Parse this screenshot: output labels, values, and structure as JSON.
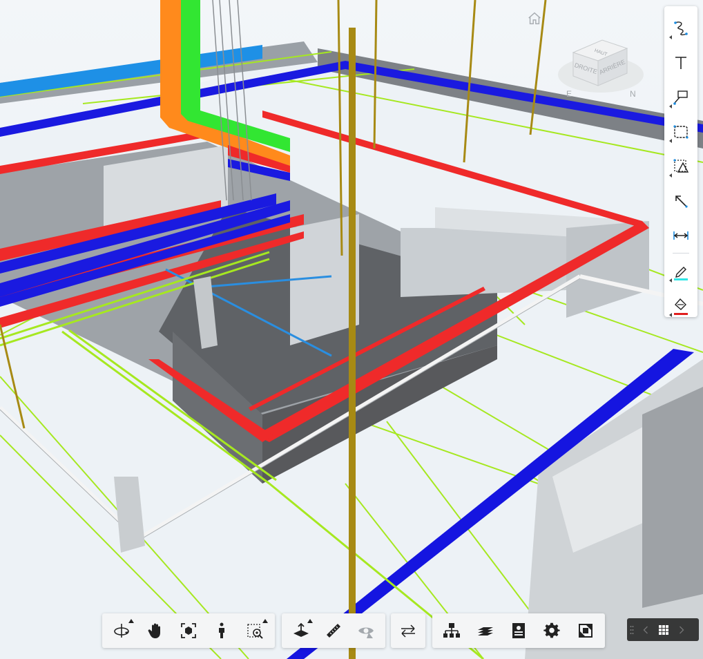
{
  "viewer": {
    "viewcube": {
      "face_top": "HAUT",
      "face_right": "DROITE",
      "face_back": "ARRIÈRE",
      "compass_east": "E",
      "compass_north": "N"
    }
  },
  "icons": {
    "home": "home-icon",
    "markup": [
      "freehand-icon",
      "text-icon",
      "callout-icon",
      "cloud-icon",
      "polygon-icon",
      "arrow-icon",
      "dimension-icon",
      "pen-color-icon",
      "fill-color-icon"
    ],
    "navigation": [
      "orbit-icon",
      "pan-icon",
      "fit-to-view-icon",
      "first-person-icon",
      "zoom-window-icon"
    ],
    "analysis": [
      "section-plane-icon",
      "measure-icon",
      "explode-icon"
    ],
    "compare": [
      "compare-icon"
    ],
    "settings": [
      "model-browser-icon",
      "layers-icon",
      "properties-icon",
      "settings-icon",
      "fullscreen-icon"
    ],
    "nav_panel": [
      "grip-icon",
      "previous-icon",
      "grid-icon",
      "next-icon"
    ]
  },
  "colors": {
    "pen_color": "#2ee6e6",
    "fill_color": "#e01e1e",
    "pipe_red": "#ef2a2a",
    "pipe_blue": "#1515e0",
    "pipe_green": "#a6e820",
    "duct_orange": "#ff8a1c",
    "duct_green": "#32e632",
    "column_gold": "#a78a14",
    "wall_grey": "#6e6e70",
    "toolbar_bg": "#f4f5f6",
    "nav_panel_bg": "#2b2b2b"
  }
}
